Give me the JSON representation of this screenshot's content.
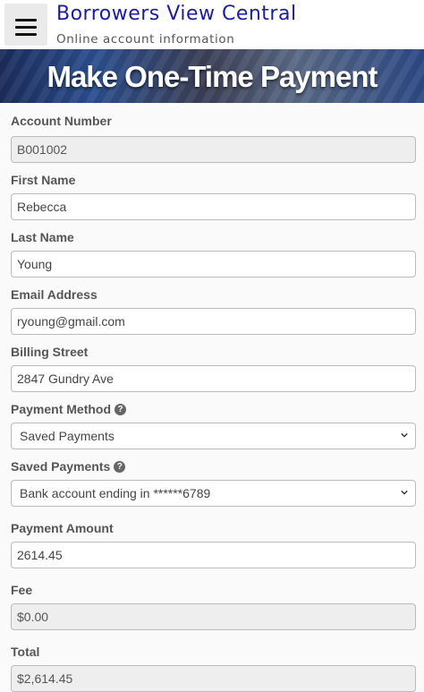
{
  "header": {
    "title": "Borrowers View Central",
    "subtitle": "Online account information",
    "menu_icon": "hamburger-menu-icon"
  },
  "banner": {
    "title": "Make One-Time Payment"
  },
  "form": {
    "account_number": {
      "label": "Account Number",
      "value": "B001002"
    },
    "first_name": {
      "label": "First Name",
      "value": "Rebecca"
    },
    "last_name": {
      "label": "Last Name",
      "value": "Young"
    },
    "email": {
      "label": "Email Address",
      "value": "ryoung@gmail.com"
    },
    "billing_street": {
      "label": "Billing Street",
      "value": "2847 Gundry Ave"
    },
    "payment_method": {
      "label": "Payment Method",
      "value": "Saved Payments",
      "help_icon": "question-circle-icon"
    },
    "saved_payments": {
      "label": "Saved Payments",
      "value": "Bank account ending in ******6789",
      "help_icon": "question-circle-icon"
    },
    "payment_amount": {
      "label": "Payment Amount",
      "value": "2614.45"
    },
    "fee": {
      "label": "Fee",
      "value": "$0.00"
    },
    "total": {
      "label": "Total",
      "value": "$2,614.45"
    }
  }
}
